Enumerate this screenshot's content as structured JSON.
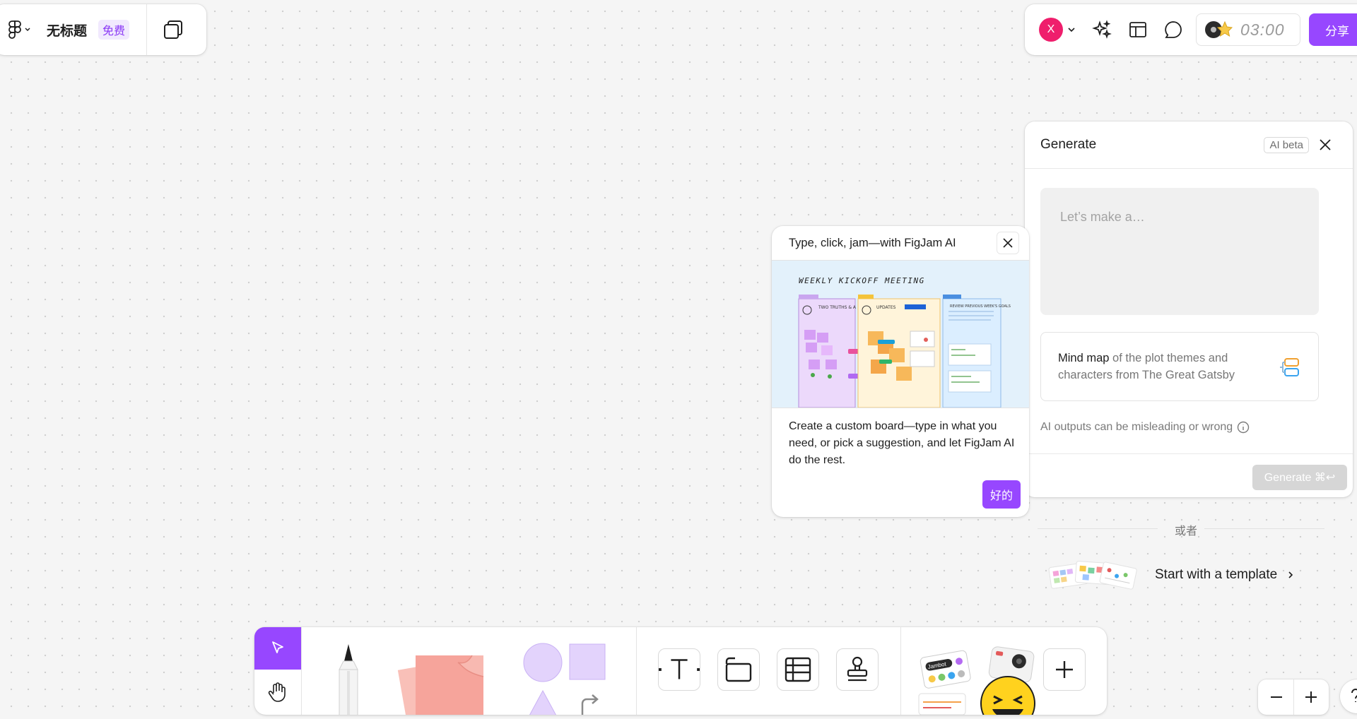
{
  "header": {
    "title": "无标题",
    "plan_badge": "免费",
    "share_label": "分享",
    "avatar_initial": "X",
    "timer": "03:00"
  },
  "generate_panel": {
    "title": "Generate",
    "badge": "AI beta",
    "prompt_placeholder": "Let’s make a…",
    "suggestion_bold": "Mind map",
    "suggestion_rest": " of the plot themes and characters from The Great Gatsby",
    "disclaimer": "AI outputs can be misleading or wrong",
    "generate_label": "Generate ⌘↩",
    "or_label": "或者",
    "template_label": "Start with a template"
  },
  "tooltip": {
    "title": "Type, click, jam—with FigJam AI",
    "board_title": "WEEKLY KICKOFF MEETING",
    "col1_title": "TWO TRUTHS & A LIE",
    "col2_title": "UPDATES",
    "col3_title": "REVIEW PREVIOUS WEEK'S GOALS",
    "body": "Create a custom board—type in what you need, or pick a suggestion, and let FigJam AI do the rest.",
    "ok_label": "好的"
  },
  "toolbar": {
    "jambot_label": "Jambot"
  },
  "colors": {
    "accent": "#9747ff",
    "avatar": "#ef1e6c",
    "sticky": "#f6a49b",
    "shape": "#e3d3fc"
  }
}
